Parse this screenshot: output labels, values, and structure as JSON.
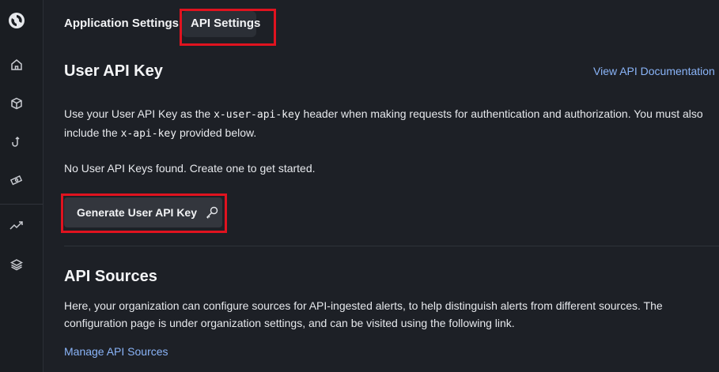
{
  "tabs": [
    {
      "label": "Application Settings",
      "active": false
    },
    {
      "label": "API Settings",
      "active": true
    }
  ],
  "user_api_key": {
    "title": "User API Key",
    "docs_link": "View API Documentation",
    "desc_part1": "Use your User API Key as the ",
    "desc_code1": "x-user-api-key",
    "desc_part2": " header when making requests for authentication and authorization. You must also include the ",
    "desc_code2": "x-api-key",
    "desc_part3": " provided below.",
    "empty_message": "No User API Keys found. Create one to get started.",
    "generate_button": "Generate User API Key"
  },
  "api_sources": {
    "title": "API Sources",
    "description": "Here, your organization can configure sources for API-ingested alerts, to help distinguish alerts from different sources. The configuration page is under organization settings, and can be visited using the following link.",
    "manage_link": "Manage API Sources"
  },
  "sidebar": {
    "icons": [
      "logo-icon",
      "home-icon",
      "box-icon",
      "hook-icon",
      "money-icon",
      "trending-icon",
      "layers-icon"
    ]
  },
  "colors": {
    "highlight": "#e0131f",
    "link": "#8ab4f8",
    "background": "#1d2026"
  }
}
